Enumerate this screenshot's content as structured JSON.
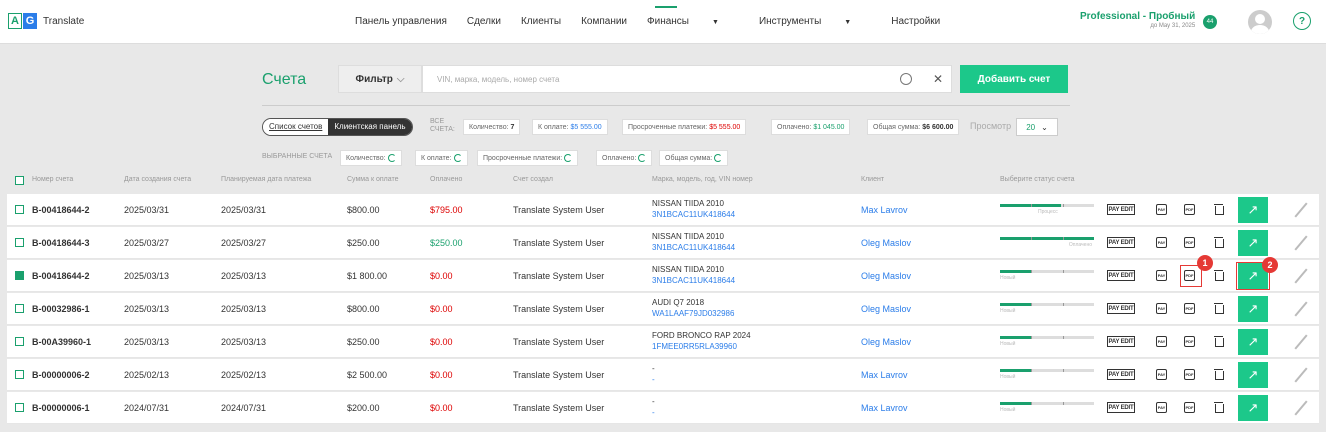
{
  "app": {
    "logo_a": "A",
    "logo_g": "G",
    "name": "Translate"
  },
  "nav": {
    "items": [
      "Панель управления",
      "Сделки",
      "Клиенты",
      "Компании"
    ],
    "active": "Финансы",
    "tools": "Инструменты",
    "settings": "Настройки"
  },
  "plan": {
    "title": "Professional - Пробный",
    "until": "до May 31, 2025"
  },
  "notify": {
    "count": "44"
  },
  "help": "?",
  "page": {
    "title": "Счета"
  },
  "search": {
    "filter_label": "Фильтр",
    "placeholder": "VIN, марка, модель, номер счета",
    "add_label": "Добавить счет"
  },
  "view": {
    "list_label": "Список счетов",
    "panel_label": "Клиентская панель"
  },
  "all": {
    "label1": "ВСЕ",
    "label2": "СЧЕТА:",
    "count_label": "Количество:",
    "count": "7",
    "due_label": "К оплате:",
    "due": "$5 555.00",
    "overdue_label": "Просроченные платежи:",
    "overdue": "$5 555.00",
    "paid_label": "Оплачено:",
    "paid": "$1 045.00",
    "total_label": "Общая сумма:",
    "total": "$6 600.00",
    "perpage_label": "Просмотр",
    "perpage": "20"
  },
  "selected": {
    "label": "ВЫБРАННЫЕ СЧЕТА",
    "count_label": "Количество:",
    "due_label": "К оплате:",
    "overdue_label": "Просроченные платежи:",
    "paid_label": "Оплачено:",
    "total_label": "Общая сумма:"
  },
  "columns": [
    "Номер счета",
    "Дата создания счета",
    "Планируемая дата платежа",
    "Сумма к оплате",
    "Оплачено",
    "Счет создал",
    "Марка, модель, год, VIN номер",
    "Клиент",
    "Выберите статус счета"
  ],
  "rows": [
    {
      "num": "B-00418644-2",
      "created": "2025/03/31",
      "planned": "2025/03/31",
      "amount": "$800.00",
      "paid": "$795.00",
      "paid_color": "red",
      "creator": "Translate System User",
      "car": "NISSAN TIIDA 2010",
      "vin": "3N1BCAC11UK418644",
      "client": "Max Lavrov",
      "status": "Процесс",
      "progress": 0.65,
      "checked": false
    },
    {
      "num": "B-00418644-3",
      "created": "2025/03/27",
      "planned": "2025/03/27",
      "amount": "$250.00",
      "paid": "$250.00",
      "paid_color": "green",
      "creator": "Translate System User",
      "car": "NISSAN TIIDA 2010",
      "vin": "3N1BCAC11UK418644",
      "client": "Oleg Maslov",
      "status": "Оплачено",
      "progress": 1.0,
      "checked": false
    },
    {
      "num": "B-00418644-2",
      "created": "2025/03/13",
      "planned": "2025/03/13",
      "amount": "$1 800.00",
      "paid": "$0.00",
      "paid_color": "red",
      "creator": "Translate System User",
      "car": "NISSAN TIIDA 2010",
      "vin": "3N1BCAC11UK418644",
      "client": "Oleg Maslov",
      "status": "Новый",
      "progress": 0.33,
      "checked": true
    },
    {
      "num": "B-00032986-1",
      "created": "2025/03/13",
      "planned": "2025/03/13",
      "amount": "$800.00",
      "paid": "$0.00",
      "paid_color": "red",
      "creator": "Translate System User",
      "car": "AUDI Q7 2018",
      "vin": "WA1LAAF79JD032986",
      "client": "Oleg Maslov",
      "status": "Новый",
      "progress": 0.33,
      "checked": false
    },
    {
      "num": "B-00A39960-1",
      "created": "2025/03/13",
      "planned": "2025/03/13",
      "amount": "$250.00",
      "paid": "$0.00",
      "paid_color": "red",
      "creator": "Translate System User",
      "car": "FORD BRONCO RAP 2024",
      "vin": "1FMEE0RR5RLA39960",
      "client": "Oleg Maslov",
      "status": "Новый",
      "progress": 0.33,
      "checked": false
    },
    {
      "num": "B-00000006-2",
      "created": "2025/02/13",
      "planned": "2025/02/13",
      "amount": "$2 500.00",
      "paid": "$0.00",
      "paid_color": "red",
      "creator": "Translate System User",
      "car": "-",
      "vin": "-",
      "client": "Max Lavrov",
      "status": "Новый",
      "progress": 0.33,
      "checked": false
    },
    {
      "num": "B-00000006-1",
      "created": "2024/07/31",
      "planned": "2024/07/31",
      "amount": "$200.00",
      "paid": "$0.00",
      "paid_color": "red",
      "creator": "Translate System User",
      "car": "-",
      "vin": "-",
      "client": "Max Lavrov",
      "status": "Новый",
      "progress": 0.33,
      "checked": false
    }
  ],
  "actions": {
    "payedit": "PAY EDIT",
    "pay": "PAY",
    "pdf": "PDF",
    "open": "↗"
  },
  "markers": {
    "one": "1",
    "two": "2"
  }
}
